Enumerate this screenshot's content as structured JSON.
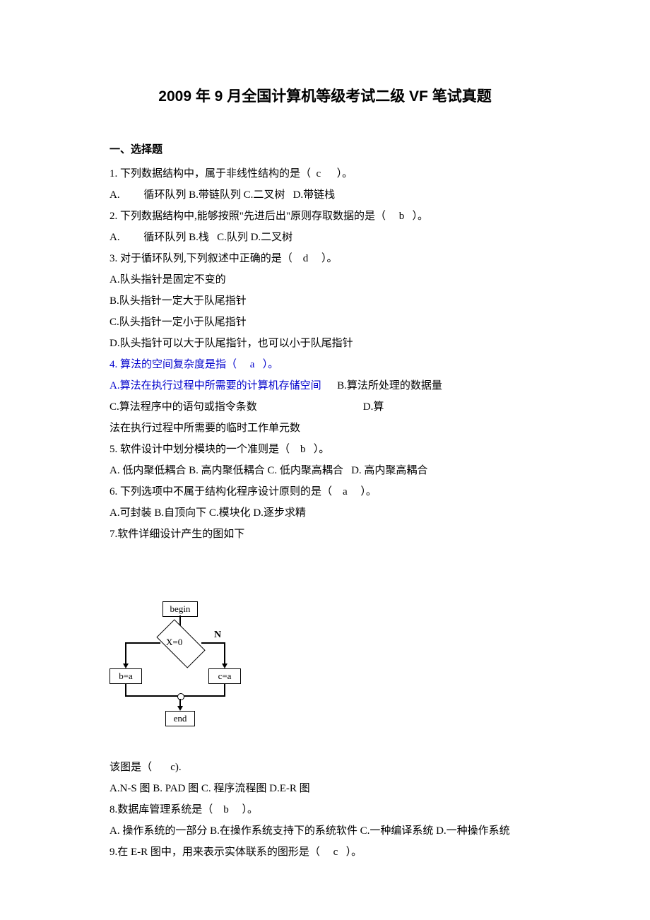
{
  "title": "2009 年 9 月全国计算机等级考试二级 VF 笔试真题",
  "section1": "一、选择题",
  "q1": "1. 下列数据结构中，属于非线性结构的是（  c      ）。",
  "q1opts": "A.         循环队列 B.带链队列 C.二叉树   D.带链栈",
  "q2": "2. 下列数据结构中,能够按照\"先进后出\"原则存取数据的是（     b   ）。",
  "q2opts": "A.         循环队列 B.栈   C.队列 D.二叉树",
  "q3": "3. 对于循环队列,下列叙述中正确的是（    d     ）。",
  "q3a": "A.队头指针是固定不变的",
  "q3b": "B.队头指针一定大于队尾指针",
  "q3c": "C.队头指针一定小于队尾指针",
  "q3d": "D.队头指针可以大于队尾指针，也可以小于队尾指针",
  "q4": "4. 算法的空间复杂度是指（     a   ）。",
  "q4a": "A.算法在执行过程中所需要的计算机存储空间",
  "q4b": "B.算法所处理的数据量",
  "q4c": "C.算法程序中的语句或指令条数                                        D.算",
  "q4c2": "法在执行过程中所需要的临时工作单元数",
  "q5": "5. 软件设计中划分模块的一个准则是（    b   ）。",
  "q5opts": "A. 低内聚低耦合 B. 高内聚低耦合 C. 低内聚高耦合   D. 高内聚高耦合",
  "q6": "6. 下列选项中不属于结构化程序设计原则的是（    a     ）。",
  "q6opts": "A.可封装 B.自顶向下 C.模块化 D.逐步求精",
  "q7": "7.软件详细设计产生的图如下",
  "fc_begin": "begin",
  "fc_cond": "X=0",
  "fc_n": "N",
  "fc_ba": "b=a",
  "fc_ca": "c=a",
  "fc_end": "end",
  "q7b": "该图是（       c).",
  "q7opts": "A.N-S 图 B. PAD 图 C. 程序流程图 D.E-R 图",
  "q8": "8.数据库管理系统是（    b     ）。",
  "q8opts": "A. 操作系统的一部分 B.在操作系统支持下的系统软件 C.一种编译系统 D.一种操作系统",
  "q9": "9.在 E-R 图中，用来表示实体联系的图形是（     c   ）。"
}
